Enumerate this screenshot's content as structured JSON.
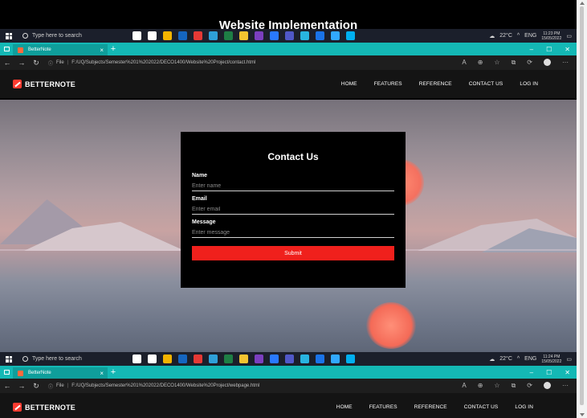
{
  "slide_title": "Website Implementation",
  "taskbar": {
    "search_placeholder": "Type here to search",
    "weather": "22°C",
    "language": "ENG",
    "icons": [
      "cortana-icon",
      "task-view-icon",
      "chrome-icon",
      "mail-icon",
      "photos-icon",
      "edge-icon",
      "excel-icon",
      "file-explorer-icon",
      "onenote-icon",
      "store-icon",
      "teams-icon",
      "vpn-icon",
      "outlook-icon",
      "photoshop-icon",
      "skype-icon"
    ],
    "icon_colors": [
      "#ffffff",
      "#ffffff",
      "#f4b400",
      "#1565c0",
      "#e53935",
      "#2ea0d8",
      "#1e7e45",
      "#f4c430",
      "#7b3fbf",
      "#2979ff",
      "#5058c8",
      "#28b4e0",
      "#1a73e8",
      "#31a8ff",
      "#00aff0"
    ]
  },
  "taskbar_top": {
    "time": "11:23 PM",
    "date": "15/05/2022"
  },
  "taskbar_bottom": {
    "time": "11:24 PM",
    "date": "15/05/2022"
  },
  "tabs": {
    "title": "BetterNote",
    "close": "×",
    "new": "+"
  },
  "window_controls": {
    "minimize": "–",
    "maximize": "☐",
    "close": "✕"
  },
  "address_top": {
    "prefix": "File",
    "url": "F:/UQ/Subjects/Semester%201%202022/DECO1400/Website%20Project/contact.html"
  },
  "address_bottom": {
    "prefix": "File",
    "url": "F:/UQ/Subjects/Semester%201%202022/DECO1400/Website%20Project/webpage.html"
  },
  "site": {
    "logo": "BETTERNOTE",
    "nav": [
      "HOME",
      "FEATURES",
      "REFERENCE",
      "CONTACT US",
      "LOG IN"
    ]
  },
  "contact_form": {
    "title": "Contact Us",
    "fields": [
      {
        "label": "Name",
        "placeholder": "Enter name"
      },
      {
        "label": "Email",
        "placeholder": "Enter email"
      },
      {
        "label": "Message",
        "placeholder": "Enter message"
      }
    ],
    "submit_label": "Submit"
  },
  "colors": {
    "accent_red": "#f0201c",
    "tab_teal": "#14b8b5",
    "taskbar": "#1b1f2b"
  }
}
